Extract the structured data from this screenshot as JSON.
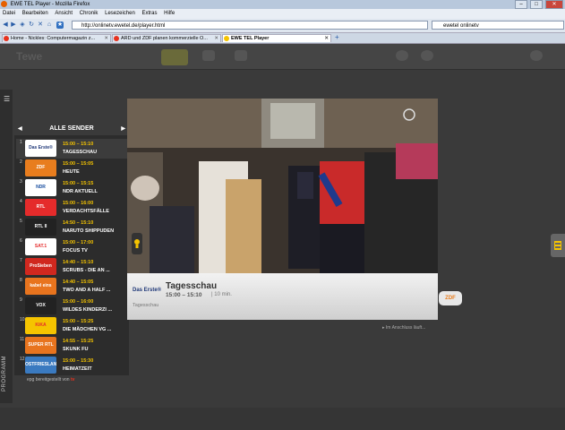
{
  "browser": {
    "window_title": "EWE TEL Player - Mozilla Firefox",
    "window_buttons": [
      "–",
      "□",
      "✕"
    ],
    "menu": [
      "Datei",
      "Bearbeiten",
      "Ansicht",
      "Chronik",
      "Lesezeichen",
      "Extras",
      "Hilfe"
    ],
    "url": "http://onlinetv.ewetel.de/player.html",
    "search_value": "ewetel onlinetv",
    "tabs": [
      {
        "label": "Home - Nickles: Computermagazin z...",
        "active": false
      },
      {
        "label": "ARD und ZDF planen kommerzielle O...",
        "active": false
      },
      {
        "label": "EWE TEL Player",
        "active": true
      }
    ],
    "new_tab": "+"
  },
  "app": {
    "logo": "Tewe",
    "menu_icon": "☰",
    "sidebar_label": "PROGRAMM",
    "channel_header": "ALLE SENDER",
    "channels": [
      {
        "num": "1",
        "logo": "Das Erste®",
        "time": "15:00 – 15:10",
        "show": "TAGESSCHAU"
      },
      {
        "num": "2",
        "logo": "ZDF",
        "time": "15:00 – 15:05",
        "show": "HEUTE"
      },
      {
        "num": "3",
        "logo": "NDR",
        "time": "15:00 – 15:15",
        "show": "NDR AKTUELL"
      },
      {
        "num": "4",
        "logo": "RTL",
        "time": "15:00 – 16:00",
        "show": "VERDACHTSFÄLLE"
      },
      {
        "num": "5",
        "logo": "RTL II",
        "time": "14:50 – 15:10",
        "show": "NARUTO SHIPPUDEN"
      },
      {
        "num": "6",
        "logo": "SAT.1",
        "time": "15:00 – 17:00",
        "show": "FOCUS TV"
      },
      {
        "num": "7",
        "logo": "ProSieben",
        "time": "14:40 – 15:10",
        "show": "SCRUBS - DIE AN ..."
      },
      {
        "num": "8",
        "logo": "kabel eins",
        "time": "14:40 – 15:05",
        "show": "TWO AND A HALF ..."
      },
      {
        "num": "9",
        "logo": "VOX",
        "time": "15:00 – 16:00",
        "show": "WILDES KINDERZI ..."
      },
      {
        "num": "10",
        "logo": "KiKA",
        "time": "15:00 – 15:25",
        "show": "DIE MÄDCHEN VG ..."
      },
      {
        "num": "11",
        "logo": "SUPER RTL",
        "time": "14:55 – 15:25",
        "show": "SKUNK FU"
      },
      {
        "num": "12",
        "logo": "OSTFRIESLAND",
        "time": "15:00 – 15:30",
        "show": "HEIMATZEIT"
      }
    ],
    "epg_note": "epg bereitgestellt von",
    "epg_brand": "tv",
    "now_playing": {
      "channel_logo": "Das Erste®",
      "title": "Tagesschau",
      "time": "15:00 – 15:10",
      "duration": "10 min.",
      "description": "Tagesschau"
    },
    "next_channel": "ZDF",
    "followup": "Im Anschluss läuft...",
    "colors": {
      "accent": "#f5c400",
      "background": "#3a3a3a",
      "panel": "#2c2c2c"
    }
  }
}
